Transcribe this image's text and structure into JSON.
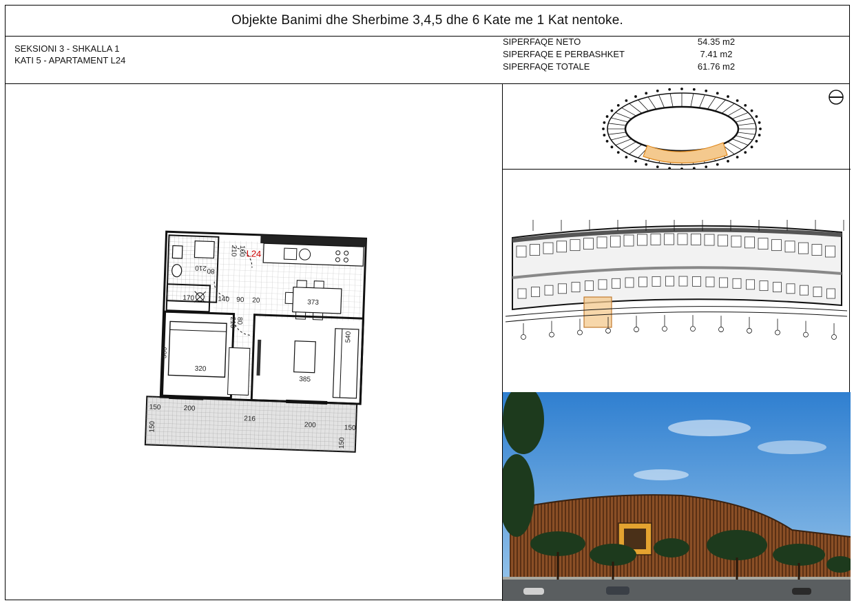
{
  "header": {
    "title": "Objekte Banimi dhe Sherbime 3,4,5 dhe 6 Kate me 1 Kat nentoke."
  },
  "apartment": {
    "section": "SEKSIONI 3 - SHKALLA 1",
    "floor_unit": "KATI 5 - APARTAMENT L24"
  },
  "areas": [
    {
      "label": "SIPERFAQE NETO",
      "value": "54.35 m2"
    },
    {
      "label": "SIPERFAQE E PERBASHKET",
      "value": "7.41 m2"
    },
    {
      "label": "SIPERFAQE TOTALE",
      "value": "61.76 m2"
    }
  ],
  "plan": {
    "unit_label": "L24",
    "dims": {
      "d100": "100",
      "d210a": "210",
      "d210b": "210",
      "d80a": "80",
      "d170": "170",
      "d140": "140",
      "d90a": "90",
      "d20": "20",
      "d373": "373",
      "d80b": "80",
      "d210c": "210",
      "d300": "300",
      "d320": "320",
      "d385": "385",
      "d540": "540",
      "d150a": "150",
      "d200a": "200",
      "d216": "216",
      "d200b": "200",
      "d150b": "150",
      "d150c": "150",
      "d150d": "150"
    }
  },
  "colors": {
    "highlight": "#e8a55a",
    "unit_label": "#cc0000",
    "wall": "#111111",
    "balcony_fill": "#d9d9d9"
  }
}
